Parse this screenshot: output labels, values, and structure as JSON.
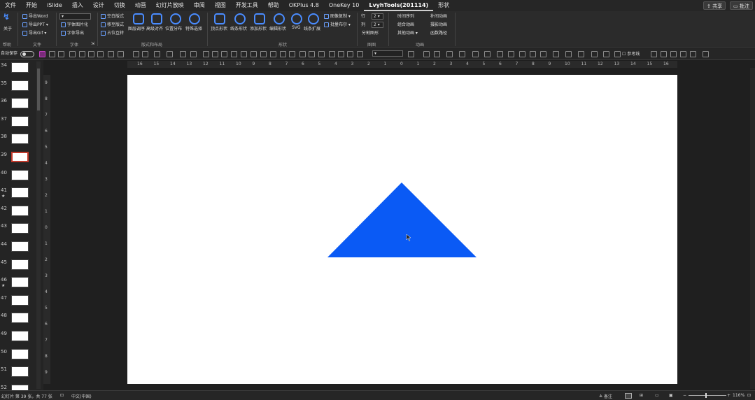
{
  "menu": {
    "tabs": [
      "文件",
      "开始",
      "iSlide",
      "插入",
      "设计",
      "切换",
      "动画",
      "幻灯片放映",
      "审阅",
      "视图",
      "开发工具",
      "帮助",
      "OKPlus 4.8",
      "OneKey 10",
      "LvyhTools(201114)",
      "形状"
    ],
    "active_index": 14,
    "share_label": "共享",
    "comment_label": "批注"
  },
  "ribbon": {
    "about_label": "关于",
    "export_word": "导出Word",
    "export_ppt": "导出PPT",
    "export_gif": "导出Gif",
    "font_pic": "字体图片化",
    "font_export": "字体导出",
    "layout_blank": "空白版式",
    "layout_remove": "移至版式",
    "placeholder_swap": "占位互转",
    "circle_sort": "图层调序",
    "align_height": "高级对齐",
    "position_dist": "位置分布",
    "special_select": "特殊选择",
    "vertex_edit": "顶点形状",
    "line_edit": "线条形状",
    "add_shape": "添加形状",
    "edit_shape": "编辑形状",
    "svg_label": "SVG",
    "line_expand": "线条扩展",
    "image_copy": "图像复制",
    "batch_bool": "批量布尔",
    "row_label": "行",
    "col_label": "列",
    "row_value": "2",
    "col_value": "2",
    "split_shape": "分割图形",
    "time_seq": "时间序列",
    "group_anim": "组合动画",
    "other_anim": "其他动画",
    "fill_anim": "补间动画",
    "copy_anim": "摄影动画",
    "func_path": "函数路径",
    "groups": {
      "help": "帮助",
      "file": "文件",
      "font": "字体",
      "layout": "版式和布局",
      "shape": "形状",
      "picture": "图图",
      "animation": "动画"
    }
  },
  "qat": {
    "autosave_label": "自动保存",
    "autosave_state": "off",
    "reference_label": "参考线"
  },
  "slides_panel": {
    "items": [
      {
        "num": "34",
        "star": ""
      },
      {
        "num": "35",
        "star": ""
      },
      {
        "num": "36",
        "star": ""
      },
      {
        "num": "37",
        "star": ""
      },
      {
        "num": "38",
        "star": ""
      },
      {
        "num": "39",
        "star": ""
      },
      {
        "num": "40",
        "star": ""
      },
      {
        "num": "41",
        "star": "★"
      },
      {
        "num": "42",
        "star": ""
      },
      {
        "num": "43",
        "star": ""
      },
      {
        "num": "44",
        "star": ""
      },
      {
        "num": "45",
        "star": ""
      },
      {
        "num": "46",
        "star": "★"
      },
      {
        "num": "47",
        "star": ""
      },
      {
        "num": "48",
        "star": ""
      },
      {
        "num": "49",
        "star": ""
      },
      {
        "num": "50",
        "star": ""
      },
      {
        "num": "51",
        "star": ""
      },
      {
        "num": "52",
        "star": ""
      }
    ],
    "selected_num": "39"
  },
  "ruler": {
    "h_labels": [
      "16",
      "15",
      "14",
      "13",
      "12",
      "11",
      "10",
      "9",
      "8",
      "7",
      "6",
      "5",
      "4",
      "3",
      "2",
      "1",
      "0",
      "1",
      "2",
      "3",
      "4",
      "5",
      "6",
      "7",
      "8",
      "9",
      "10",
      "11",
      "12",
      "13",
      "14",
      "15",
      "16"
    ],
    "v_labels": [
      "9",
      "8",
      "7",
      "6",
      "5",
      "4",
      "3",
      "2",
      "1",
      "0",
      "1",
      "2",
      "3",
      "4",
      "5",
      "6",
      "7",
      "8",
      "9"
    ]
  },
  "slide": {
    "triangle_color": "#0a5af5"
  },
  "status": {
    "slide_info": "幻灯片 第 39 张，共 77 张",
    "language": "中文(中国)",
    "notes_label": "备注",
    "zoom": "116%"
  }
}
